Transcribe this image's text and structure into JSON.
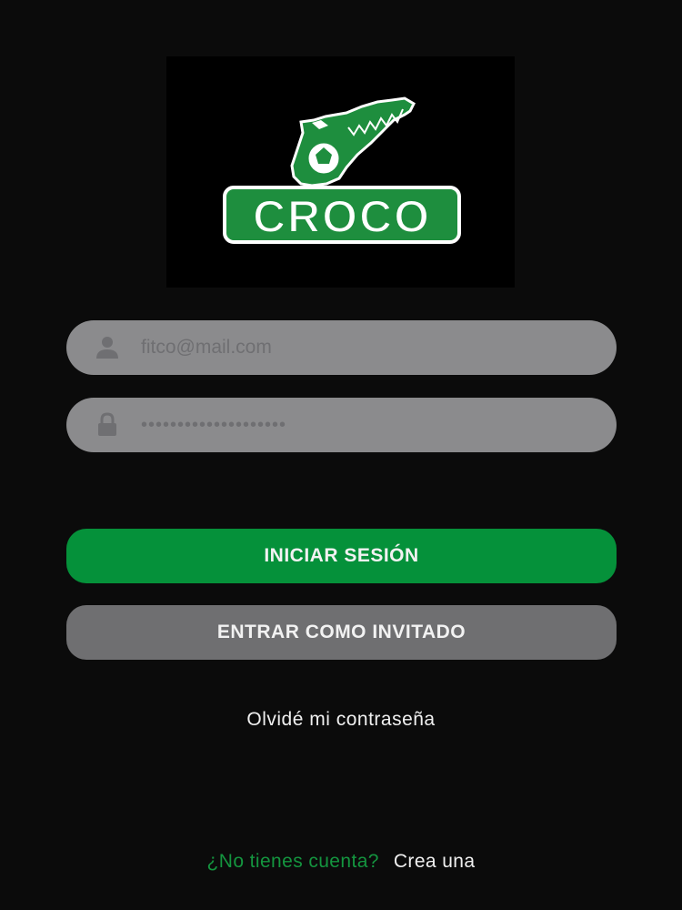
{
  "logo": {
    "text": "CROCO",
    "brand_color": "#1e8e3e"
  },
  "login": {
    "email_placeholder": "fitco@mail.com",
    "password_value": "••••••••••••••••••••",
    "email_icon": "user-icon",
    "password_icon": "lock-icon"
  },
  "buttons": {
    "login_label": "INICIAR SESIÓN",
    "guest_label": "ENTRAR COMO INVITADO"
  },
  "links": {
    "forgot_password": "Olvidé mi contraseña",
    "no_account": "¿No tienes cuenta?",
    "create_account": "Crea una"
  },
  "colors": {
    "background": "#0b0b0b",
    "field": "#8b8b8d",
    "primary": "#05913a",
    "secondary": "#6f6f71",
    "accent_text": "#14953f"
  }
}
